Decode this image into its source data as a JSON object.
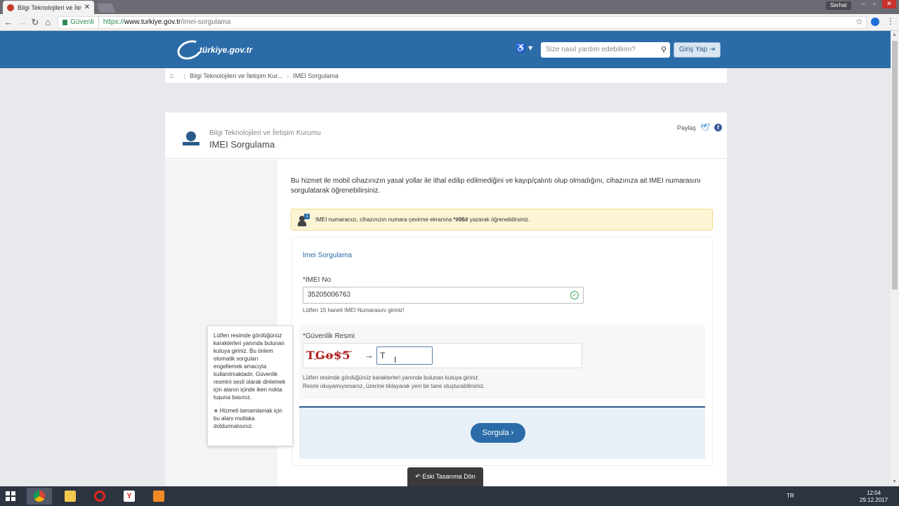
{
  "browser": {
    "tab_title": "Bilgi Teknolojileri ve İleti",
    "tab_close": "✕",
    "user_chip": "Serhat",
    "secure_label": "Güvenli",
    "url_scheme": "https://",
    "url_host": "www.turkiye.gov.tr",
    "url_path": "/imei-sorgulama"
  },
  "header": {
    "logo_text": "türkiye.gov.tr",
    "search_placeholder": "Size nasıl yardım edebilirim?",
    "login_label": "Giriş Yap"
  },
  "breadcrumb": {
    "items": [
      "Bilgi Teknolojileri ve İletişim Kur...",
      "IMEI Sorgulama"
    ]
  },
  "card": {
    "institution": "Bilgi Teknolojileri ve İletişim Kurumu",
    "title": "IMEI Sorgulama",
    "share_label": "Paylaş",
    "fb_letter": "f"
  },
  "content": {
    "intro": "Bu hizmet ile mobil cihazınızın yasal yollar ile ithal edilip edilmediğini ve kayıp/çalıntı olup olmadığını, cihazınıza ait IMEI numarasını sorgulatarak öğrenebilirsiniz.",
    "info_prefix": "IMEI numaranızı, cihazınızın numara çevirme ekranına ",
    "info_code": "*#06#",
    "info_suffix": " yazarak öğrenebilirsiniz.",
    "info_badge": "1"
  },
  "form": {
    "title": "Imei Sorgulama",
    "imei_label": "*IMEI No",
    "imei_value": "35205006763",
    "imei_hint": "Lütfen 15 haneli IMEI Numarasını giriniz!",
    "captcha_label": "*Güvenlik Resmi",
    "captcha_text": "TGo$5",
    "captcha_value": "T",
    "captcha_hint_1": "Lütfen resimde gördüğünüz karakterleri yanında bulunan kutuya giriniz.",
    "captcha_hint_2": "Resmi okuyamıyorsanız, üzerine tıklayarak yeni bir tane oluşturabilirsiniz.",
    "submit_label": "Sorgula  ›"
  },
  "tooltip": {
    "text_1": "Lütfen resimde gördüğünüz karakterleri yanında bulunan kutuya giriniz. Bu önlem otomatik sorguları engellemek amacıyla kullanılmaktadır. Güvenlik resmini sesli olarak dinlemek için alanın içinde iken nokta tuşuna basınız.",
    "text_2": "∗ Hizmeti tamamlamak için bu alanı mutlaka doldurmalısınız."
  },
  "old_design_label": "↶ Eski Tasarıma Dön",
  "taskbar": {
    "lang": "TR",
    "time": "12:04",
    "date": "29.12.2017"
  },
  "colors": {
    "header_blue": "#2b6ca8",
    "info_yellow": "#fcf5d5",
    "captcha_red": "#b11f1f"
  }
}
